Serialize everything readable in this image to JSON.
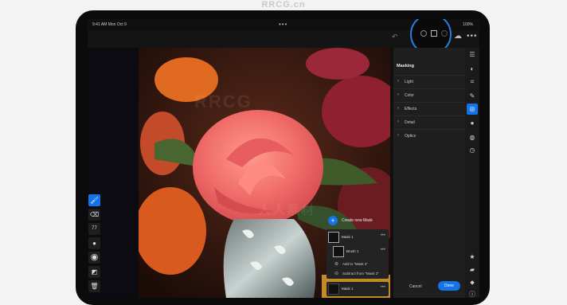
{
  "watermark": "RRCG.cn",
  "status": {
    "time": "9:41 AM  Mon Oct 9",
    "battery": "100%"
  },
  "topbar": {
    "undo_icon": "undo-icon",
    "cloud_icon": "cloud-icon",
    "more_icon": "more-icon"
  },
  "masking": {
    "title": "Masking",
    "rows": [
      {
        "label": "Light"
      },
      {
        "label": "Color"
      },
      {
        "label": "Effects"
      },
      {
        "label": "Detail"
      },
      {
        "label": "Optics"
      }
    ],
    "cancel": "Cancel",
    "done": "Done"
  },
  "layers": {
    "create_label": "Create new Mask",
    "mask1": "Mask 1",
    "brush": "Brush 1",
    "add": "Add to \"Mask 2\"",
    "subtract": "Subtract from \"Mask 2\"",
    "mask2": "Mask 1"
  },
  "tools": {
    "size_value": "77"
  },
  "colors": {
    "accent": "#1473e6",
    "rose": "#f0726f"
  }
}
